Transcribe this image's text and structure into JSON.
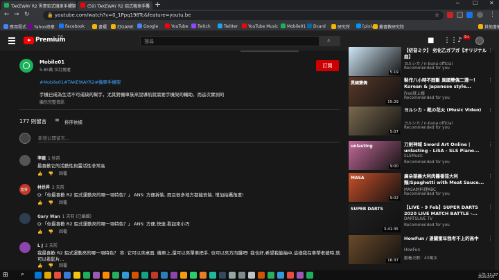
{
  "browser": {
    "tabs": [
      {
        "title": "TAKEWAY R2 黑豪鋁式機車手機架",
        "favicon_color": "#1bb05a",
        "active": false
      },
      {
        "title": "(59) TAKEWAY R2 鋁式機車手機",
        "favicon_color": "#ff0000",
        "active": true
      }
    ],
    "new_tab": "+",
    "url": "youtube.com/watch?v=0_1Ppq198Tc&feature=youtu.be",
    "bookmarks": [
      {
        "label": "應用程式",
        "color": "#4285f4"
      },
      {
        "label": "Yahoo奇摩",
        "color": "#7b0099"
      },
      {
        "label": "Facebook",
        "color": "#1877f2"
      },
      {
        "label": "書櫃",
        "color": "#f4b400"
      },
      {
        "label": "打GAME",
        "color": "#f4b400"
      },
      {
        "label": "Google",
        "color": "#4285f4"
      },
      {
        "label": "YouTube",
        "color": "#ff0000"
      },
      {
        "label": "Twitch",
        "color": "#9146ff"
      },
      {
        "label": "Twitter",
        "color": "#1da1f2"
      },
      {
        "label": "YouTube Music",
        "color": "#ff0000"
      },
      {
        "label": "Mobile01",
        "color": "#1bb05a"
      },
      {
        "label": "Dcard",
        "color": "#006aa6"
      },
      {
        "label": "研究所",
        "color": "#f4b400"
      },
      {
        "label": "[pixiv]",
        "color": "#0096fa"
      },
      {
        "label": "叢書教研究院",
        "color": "#f4b400"
      },
      {
        "label": "其他書籤",
        "color": "#f4b400"
      }
    ]
  },
  "header": {
    "logo_text": "Premium",
    "search_placeholder": "搜尋",
    "notif_count": "9+"
  },
  "video": {
    "channel_name": "Mobile01",
    "subscribers": "5.85萬 位訂閱者",
    "subscribe_label": "訂閱",
    "hashtags": "#Mobile01#TAKEWAYR2#機車手機架",
    "description": "手機已成為生活不可或缺的幫手，尤其對機車族來說導航就需要手機架的輔助，而這次實測的",
    "show_more": "顯示完整資訊"
  },
  "comments_section": {
    "count": "177 則留言",
    "sort_label": "排序依據",
    "add_placeholder": "新增公開留言...",
    "comments": [
      {
        "author": "準職",
        "time": "1 秒前",
        "text": "最喜歡它的活動性與靈活性非常高",
        "avatar_color": "#555555",
        "avatar_text": ""
      },
      {
        "author": "林世昇",
        "time": "2 天前",
        "text": "Q:「你最喜歡 R2 鋁式運動夾的哪一項特色？」 ANS: 方便拆裝, 而且很多地方都能安裝, 增加拍攝角度!",
        "avatar_color": "#c0392b",
        "avatar_text": "宏昇"
      },
      {
        "author": "Gary Wan",
        "time": "1 天前 (已編輯)",
        "text": "Q:「你最喜歡 R2 鋁式運動夾的哪一項特色？」 ANS: 方便,快速,看起來小巧",
        "avatar_color": "#2c3e50",
        "avatar_text": ""
      },
      {
        "author": "L J",
        "time": "2 天前",
        "text": "我最喜歡 R2 鋁式運動夾的哪一項特色？ 答: 它可以夾桌面, 機車上,還可以夾單車把手, 也可以夾方向盤吧! 我也好,希望我能抽中,這樣我在車帶老婆時,就",
        "text2": "可以看影片...",
        "avatar_color": "#8e44ad",
        "avatar_text": ""
      }
    ],
    "reply_label": "回覆"
  },
  "sidebar": {
    "videos": [
      {
        "title": "【初音ミク】 劣化乙ガブガ【オリジナル曲】",
        "channel": "ヨルシカ / n-buna official",
        "sub": "Recommended for you",
        "duration": "5:19",
        "thumb_color": "#cfe7f5",
        "thumb_caption": ""
      },
      {
        "title": "製作八小時不間斷 異國雙偶二選一！Korean & Japanese style...",
        "channel": "Fred就上癮",
        "sub": "Recommended for you",
        "duration": "15:29",
        "thumb_color": "#5a3a2a",
        "thumb_caption": "異國雙偶"
      },
      {
        "title": "ヨルシカ - 靴の花火 (Music Video)",
        "channel": "ヨルシカ / n-buna official",
        "sub": "Recommended for you",
        "duration": "5:07",
        "thumb_color": "#7a6a50",
        "thumb_caption": ""
      },
      {
        "title": "刀劍神域 Sword Art Online | unlasting - LiSA - SLS Piano...",
        "channel": "SLSMusic",
        "sub": "Recommended for you",
        "duration": "9:00",
        "thumb_color": "#c46a9a",
        "thumb_caption": "unlasting"
      },
      {
        "title": "廣朵菜義大利肉醬番茄大利麵/Spaghetti with Meat Sauce...",
        "channel": "MASA的料理ABC",
        "sub": "Recommended for you",
        "duration": "9:02",
        "thumb_color": "#c8502a",
        "thumb_caption": "MASA"
      },
      {
        "title": "【LIVE - 9 Feb】SUPER DARTS 2020 LIVE MATCH BATTLE -...",
        "channel": "DARTSLIVE TV",
        "sub": "Recommended for you",
        "duration": "3:41:35",
        "thumb_color": "#222222",
        "thumb_caption": "SUPER DARTS"
      },
      {
        "title": "HowFun / 憑闖蜜年我考不上的高中",
        "channel": "HowFun",
        "sub": "觀看次數：43萬次",
        "duration": "16:37",
        "thumb_color": "#6b4a2a",
        "thumb_caption": ""
      }
    ]
  },
  "taskbar": {
    "time": "上午 11:37",
    "date": "2020/2/10",
    "icons": [
      "#0078d7",
      "#e0a800",
      "#e74c3c",
      "#3a7bd5",
      "#f1c40f",
      "#1bb05a",
      "#9b59b6",
      "#ff8c00",
      "#27ae60",
      "#3498db",
      "#d35400",
      "#16a085",
      "#c0392b",
      "#2980b9",
      "#8e44ad",
      "#f39c12",
      "#2ecc71",
      "#e67e22",
      "#1abc9c",
      "#34495e",
      "#95a5a6",
      "#7f8c8d",
      "#bdc3c7",
      "#d35400",
      "#27ae60",
      "#3498db",
      "#e74c3c",
      "#9b59b6",
      "#1bb05a"
    ]
  }
}
